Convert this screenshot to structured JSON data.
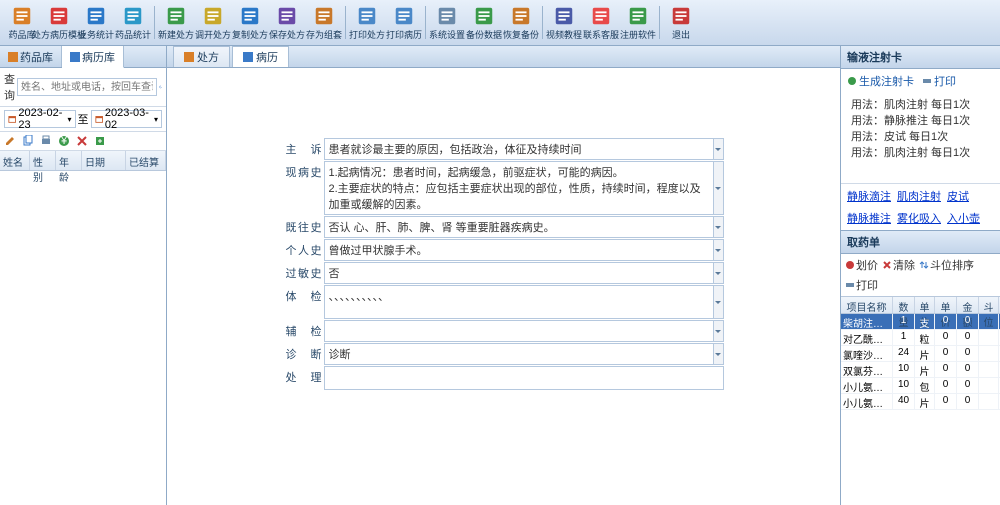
{
  "toolbar": [
    {
      "name": "drug-lib",
      "label": "药品库",
      "color": "#d97f28"
    },
    {
      "name": "rx-template",
      "label": "处方病历模板",
      "color": "#d93a3a"
    },
    {
      "name": "biz-stats",
      "label": "业务统计",
      "color": "#2a78c8"
    },
    {
      "name": "drug-stats",
      "label": "药品统计",
      "color": "#2a98c8"
    },
    {
      "name": "sep"
    },
    {
      "name": "new-rx",
      "label": "新建处方",
      "color": "#3a9a4a"
    },
    {
      "name": "open-rx",
      "label": "调开处方",
      "color": "#c8a82a"
    },
    {
      "name": "copy-rx",
      "label": "复制处方",
      "color": "#2a78c8"
    },
    {
      "name": "save-rx",
      "label": "保存处方",
      "color": "#6a4aa8"
    },
    {
      "name": "save-draft",
      "label": "存为组套",
      "color": "#c8782a"
    },
    {
      "name": "sep"
    },
    {
      "name": "print-rx",
      "label": "打印处方",
      "color": "#4a88c8"
    },
    {
      "name": "print-record",
      "label": "打印病历",
      "color": "#4a88c8"
    },
    {
      "name": "sep"
    },
    {
      "name": "sys-settings",
      "label": "系统设置",
      "color": "#6a8aaa"
    },
    {
      "name": "backup",
      "label": "备份数据",
      "color": "#3a9a4a"
    },
    {
      "name": "restore",
      "label": "恢复备份",
      "color": "#c8782a"
    },
    {
      "name": "sep"
    },
    {
      "name": "video-tutorial",
      "label": "视频教程",
      "color": "#4a5aa8"
    },
    {
      "name": "contact",
      "label": "联系客服",
      "color": "#e84a4a"
    },
    {
      "name": "register",
      "label": "注册软件",
      "color": "#3a9a4a"
    },
    {
      "name": "sep"
    },
    {
      "name": "exit",
      "label": "退出",
      "color": "#c83a3a"
    }
  ],
  "left": {
    "tabs": [
      "药品库",
      "病历库"
    ],
    "search_label": "查询",
    "search_ph": "姓名、地址或电话，按回车查询",
    "date_from": "2023-02-23",
    "date_to": "2023-03-02",
    "date_sep": "至",
    "cols": [
      "姓名",
      "性别",
      "年龄",
      "日期",
      "已结算"
    ]
  },
  "center": {
    "tabs": [
      "处方",
      "病历"
    ],
    "rows": [
      {
        "label": "主 诉",
        "value": "患者就诊最主要的原因，包括政治，体征及持续时间",
        "dd": true
      },
      {
        "label": "现病史",
        "value": "1.起病情况：患者时间，起病缓急，前驱症状，可能的病因。\n2.主要症状的特点：应包括主要症状出现的部位，性质，持续时间，程度以及加重或缓解的因素。",
        "tall": true,
        "dd": true
      },
      {
        "label": "既往史",
        "value": "否认 心、肝、肺、脾、肾 等重要脏器疾病史。",
        "dd": true
      },
      {
        "label": "个人史",
        "value": "曾做过甲状腺手术。",
        "dd": true
      },
      {
        "label": "过敏史",
        "value": "否",
        "dd": true
      },
      {
        "label": "体 检",
        "value": "、、、、、、、、、、",
        "tall3": true,
        "dd": true
      },
      {
        "label": "辅 检",
        "value": "",
        "dd": true
      },
      {
        "label": "诊 断",
        "value": "诊断",
        "dd": true
      },
      {
        "label": "处 理",
        "value": "",
        "tall2": true,
        "dd": false
      }
    ]
  },
  "right": {
    "card_title": "输液注射卡",
    "card_tools": [
      "生成注射卡",
      "打印"
    ],
    "usages": [
      "用法：肌肉注射    每日1次",
      "用法：静脉推注    每日1次",
      "用法：皮试  每日1次",
      "用法：肌肉注射    每日1次"
    ],
    "links": [
      "静脉滴注",
      "肌肉注射",
      "皮试",
      "静脉推注",
      "雾化吸入",
      "入小壶"
    ],
    "med_title": "取药单",
    "med_tools": [
      "划价",
      "清除",
      "斗位排序",
      "打印"
    ],
    "med_cols": [
      "项目名称",
      "数量",
      "单位",
      "单价",
      "金额",
      "斗位"
    ],
    "meds": [
      {
        "n": "柴胡注射液",
        "q": "1",
        "u": "支",
        "p": "0",
        "a": "0",
        "d": ""
      },
      {
        "n": "对乙酰氨基…",
        "q": "1",
        "u": "粒",
        "p": "0",
        "a": "0",
        "d": ""
      },
      {
        "n": "氯喹沙宗片",
        "q": "24",
        "u": "片",
        "p": "0",
        "a": "0",
        "d": ""
      },
      {
        "n": "双氯芬酸钠…",
        "q": "10",
        "u": "片",
        "p": "0",
        "a": "0",
        "d": ""
      },
      {
        "n": "小儿氨酚黄…",
        "q": "10",
        "u": "包",
        "p": "0",
        "a": "0",
        "d": ""
      },
      {
        "n": "小儿氨酚黄…",
        "q": "40",
        "u": "片",
        "p": "0",
        "a": "0",
        "d": ""
      }
    ]
  }
}
